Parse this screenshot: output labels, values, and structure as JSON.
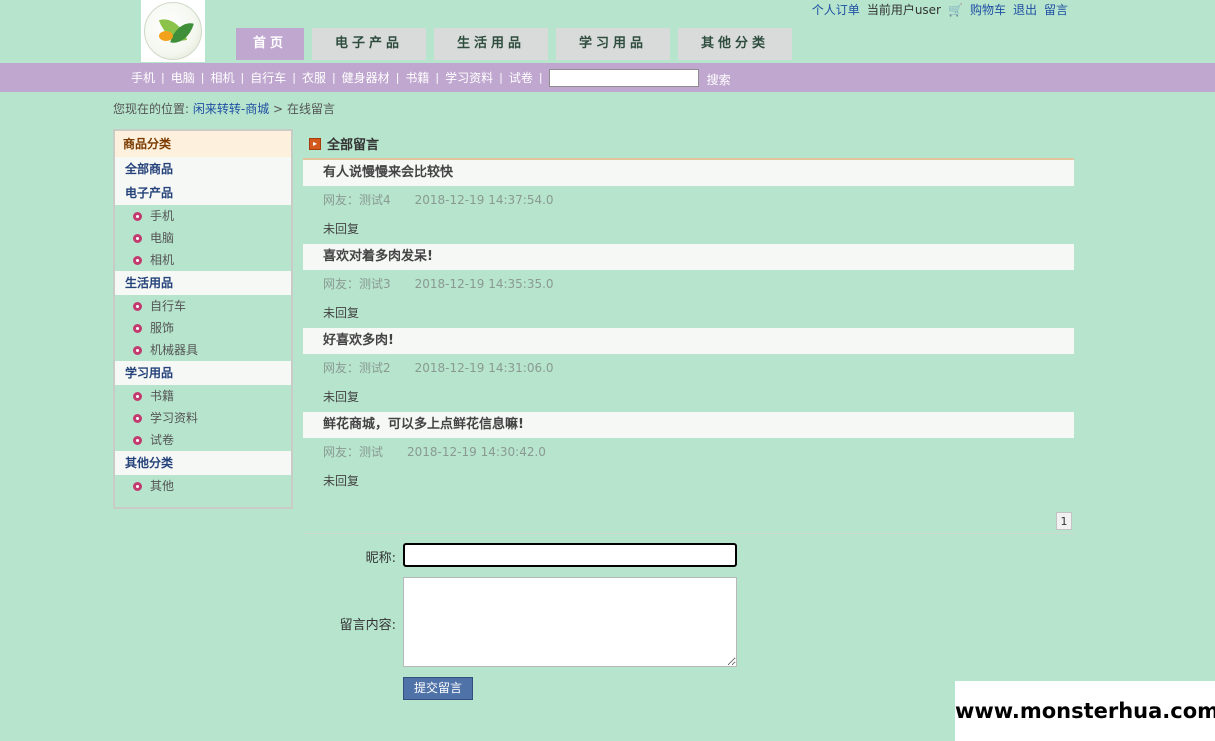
{
  "header": {
    "toplinks": {
      "orders": "个人订单",
      "current_user": "当前用户user",
      "cart": "购物车",
      "logout": "退出",
      "guestbook": "留言"
    },
    "tabs": [
      "首页",
      "电子产品",
      "生活用品",
      "学习用品",
      "其他分类"
    ]
  },
  "catbar": {
    "links": [
      "手机",
      "电脑",
      "相机",
      "自行车",
      "衣服",
      "健身器材",
      "书籍",
      "学习资料",
      "试卷"
    ],
    "search_value": "",
    "search_button": "搜索"
  },
  "breadcrumb": {
    "prefix": "您现在的位置:",
    "home": "闲来转转-商城",
    "sep": ">",
    "current": "在线留言"
  },
  "sidebar": {
    "title": "商品分类",
    "all": "全部商品",
    "categories": [
      {
        "name": "电子产品",
        "items": [
          "手机",
          "电脑",
          "相机"
        ]
      },
      {
        "name": "生活用品",
        "items": [
          "自行车",
          "服饰",
          "机械器具"
        ]
      },
      {
        "name": "学习用品",
        "items": [
          "书籍",
          "学习资料",
          "试卷"
        ]
      },
      {
        "name": "其他分类",
        "items": [
          "其他"
        ]
      }
    ]
  },
  "main": {
    "title": "全部留言",
    "messages": [
      {
        "subject": "有人说慢慢来会比较快",
        "author": "网友：测试4",
        "time": "2018-12-19 14:37:54.0",
        "reply": "未回复"
      },
      {
        "subject": "喜欢对着多肉发呆!",
        "author": "网友：测试3",
        "time": "2018-12-19 14:35:35.0",
        "reply": "未回复"
      },
      {
        "subject": "好喜欢多肉!",
        "author": "网友：测试2",
        "time": "2018-12-19 14:31:06.0",
        "reply": "未回复"
      },
      {
        "subject": "鲜花商城，可以多上点鲜花信息嘛!",
        "author": "网友：测试",
        "time": "2018-12-19 14:30:42.0",
        "reply": "未回复"
      }
    ],
    "page": "1"
  },
  "form": {
    "nickname_label": "昵称:",
    "nickname_value": "",
    "content_label": "留言内容:",
    "content_value": "",
    "submit": "提交留言"
  },
  "watermark": "www.monsterhua.com",
  "colors": {
    "background": "#b6e4cd",
    "nav_active": "#c0a7cf",
    "category_bar": "#c0a7cf",
    "link": "#1f4fa3",
    "submit": "#4f72a8"
  }
}
